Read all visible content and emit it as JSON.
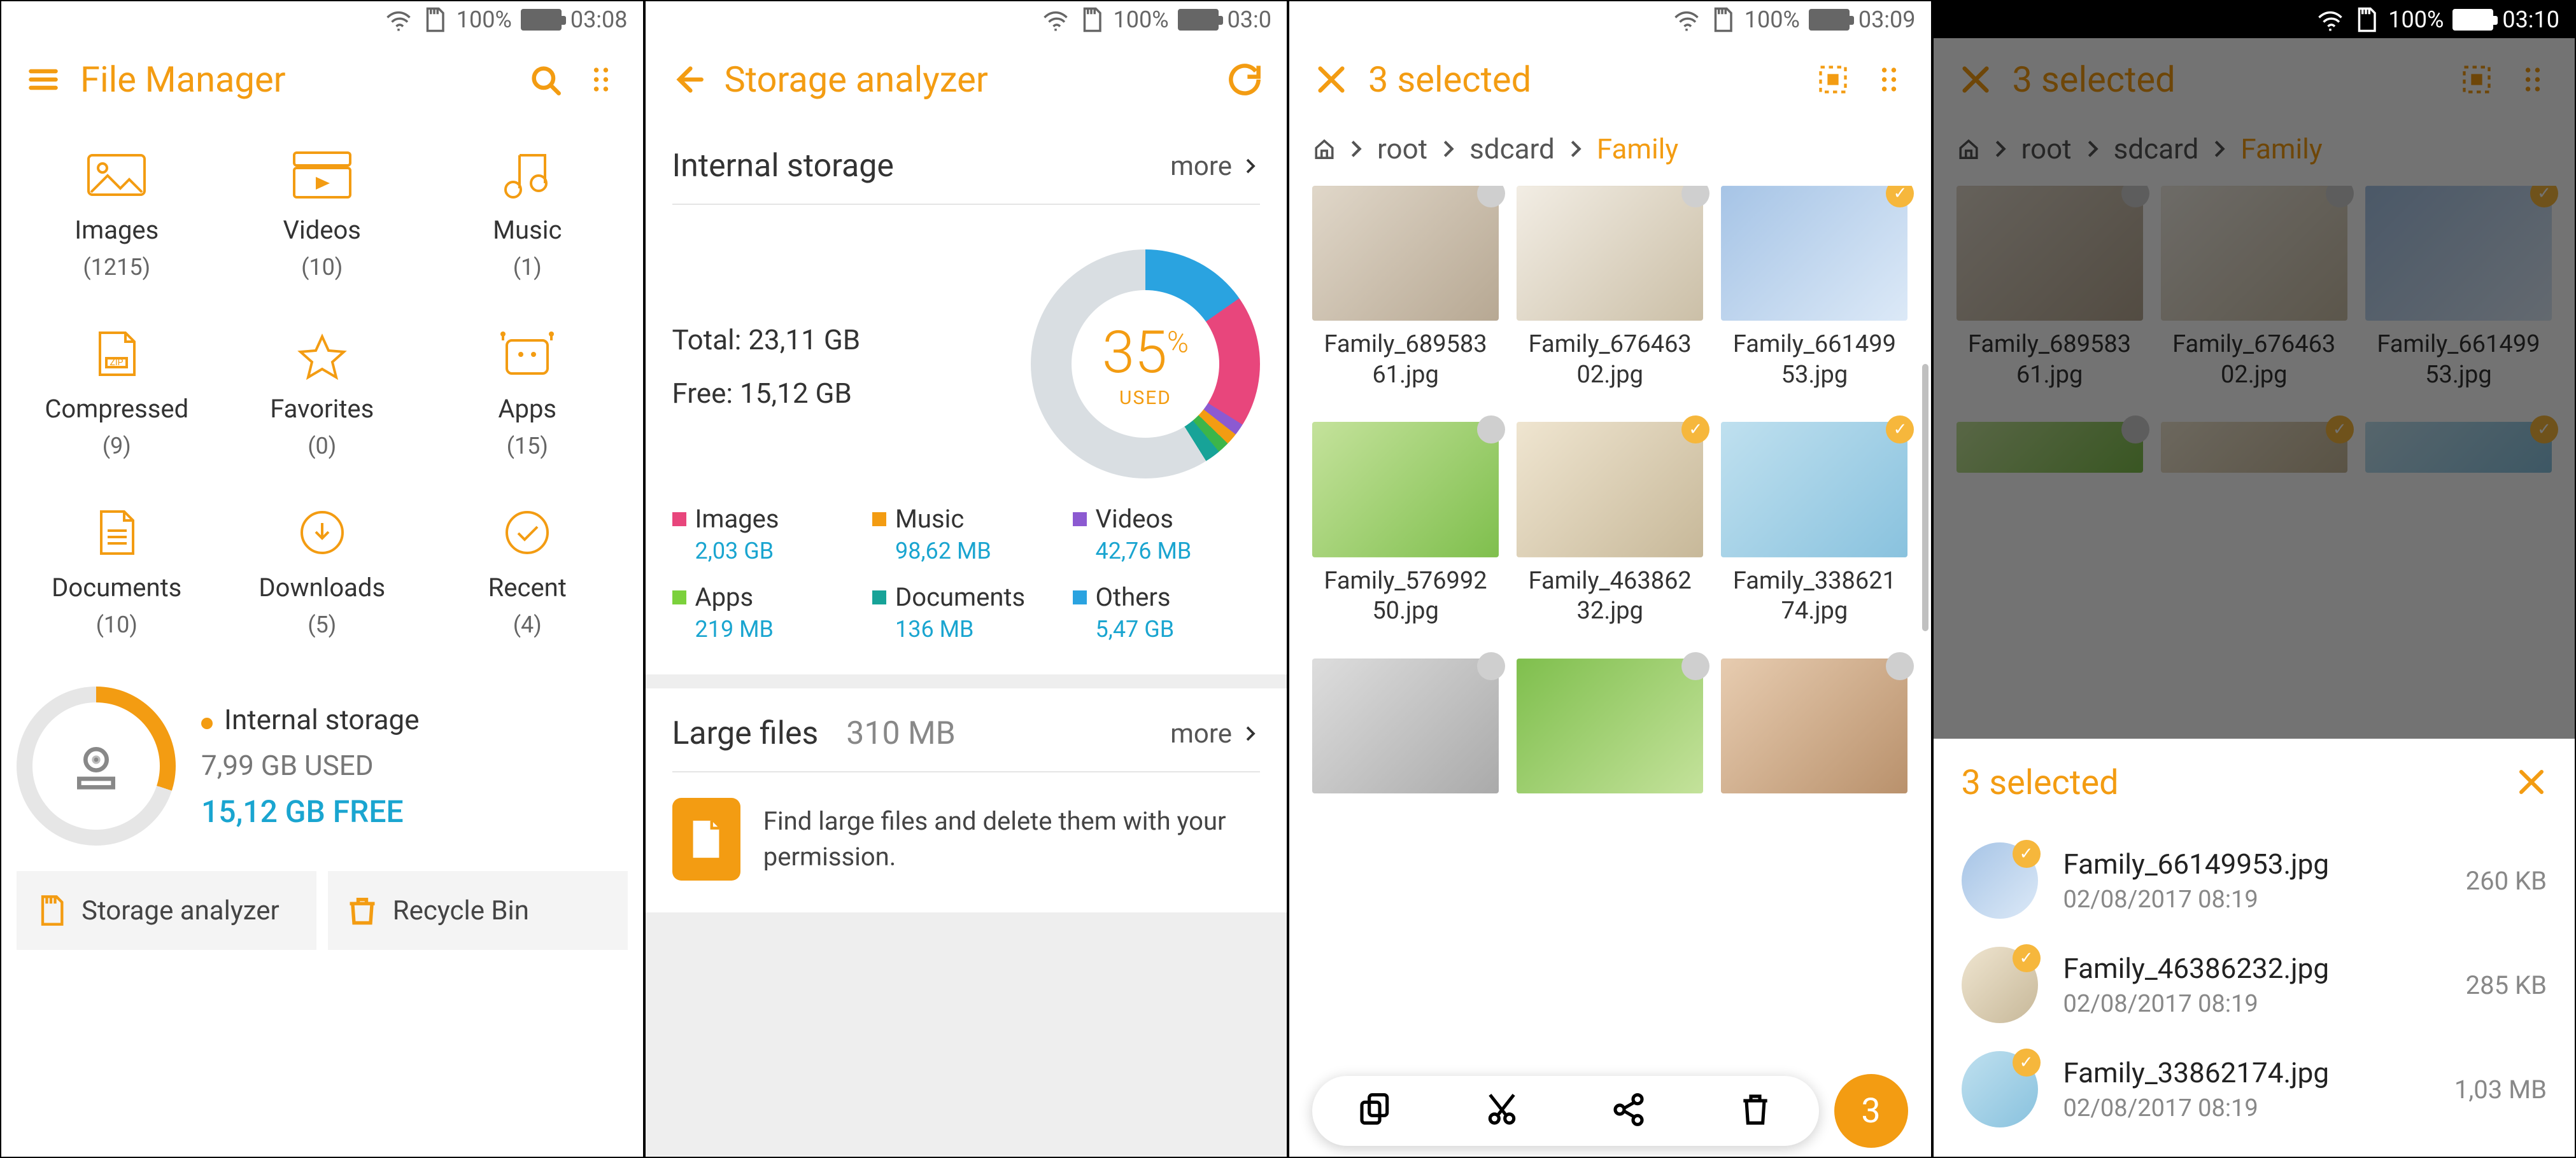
{
  "screen1": {
    "status": {
      "battery": "100%",
      "time": "03:08"
    },
    "title": "File Manager",
    "categories": [
      {
        "label": "Images",
        "count": "(1215)"
      },
      {
        "label": "Videos",
        "count": "(10)"
      },
      {
        "label": "Music",
        "count": "(1)"
      },
      {
        "label": "Compressed",
        "count": "(9)"
      },
      {
        "label": "Favorites",
        "count": "(0)"
      },
      {
        "label": "Apps",
        "count": "(15)"
      },
      {
        "label": "Documents",
        "count": "(10)"
      },
      {
        "label": "Downloads",
        "count": "(5)"
      },
      {
        "label": "Recent",
        "count": "(4)"
      }
    ],
    "storage": {
      "name": "Internal storage",
      "used": "7,99 GB USED",
      "free": "15,12 GB FREE"
    },
    "tiles": {
      "analyzer": "Storage analyzer",
      "recycle": "Recycle Bin"
    }
  },
  "screen2": {
    "status": {
      "battery": "100%",
      "time": "03:0"
    },
    "title": "Storage analyzer",
    "internal": {
      "heading": "Internal storage",
      "more": "more",
      "total_label": "Total:",
      "total_value": "23,11 GB",
      "free_label": "Free:",
      "free_value": "15,12 GB",
      "used_pct": "35",
      "used_unit": "%",
      "used_label": "USED",
      "legend": [
        {
          "name": "Images",
          "value": "2,03 GB",
          "cls": "c-img"
        },
        {
          "name": "Music",
          "value": "98,62 MB",
          "cls": "c-mus"
        },
        {
          "name": "Videos",
          "value": "42,76 MB",
          "cls": "c-vid"
        },
        {
          "name": "Apps",
          "value": "219 MB",
          "cls": "c-app"
        },
        {
          "name": "Documents",
          "value": "136 MB",
          "cls": "c-doc"
        },
        {
          "name": "Others",
          "value": "5,47 GB",
          "cls": "c-oth"
        }
      ]
    },
    "large": {
      "heading": "Large files",
      "size": "310 MB",
      "more": "more",
      "desc": "Find large files and delete them with your permission."
    }
  },
  "screen3": {
    "status": {
      "battery": "100%",
      "time": "03:09"
    },
    "title": "3 selected",
    "crumbs": {
      "root": "root",
      "sd": "sdcard",
      "cur": "Family"
    },
    "files": [
      {
        "name": "Family_68958361.jpg",
        "sel": false,
        "cls": "p1"
      },
      {
        "name": "Family_67646302.jpg",
        "sel": false,
        "cls": "p2"
      },
      {
        "name": "Family_66149953.jpg",
        "sel": true,
        "cls": "p3"
      },
      {
        "name": "Family_57699250.jpg",
        "sel": false,
        "cls": "p4"
      },
      {
        "name": "Family_46386232.jpg",
        "sel": true,
        "cls": "p5"
      },
      {
        "name": "Family_33862174.jpg",
        "sel": true,
        "cls": "p6"
      }
    ],
    "fab": "3"
  },
  "screen4": {
    "status": {
      "battery": "100%",
      "time": "03:10"
    },
    "title": "3 selected",
    "crumbs": {
      "root": "root",
      "sd": "sdcard",
      "cur": "Family"
    },
    "files": [
      {
        "name": "Family_68958361.jpg",
        "sel": false,
        "cls": "p1"
      },
      {
        "name": "Family_67646302.jpg",
        "sel": false,
        "cls": "p2"
      },
      {
        "name": "Family_66149953.jpg",
        "sel": true,
        "cls": "p3"
      }
    ],
    "sheet": {
      "title": "3 selected",
      "rows": [
        {
          "name": "Family_66149953.jpg",
          "date": "02/08/2017 08:19",
          "size": "260 KB",
          "cls": "ava3"
        },
        {
          "name": "Family_46386232.jpg",
          "date": "02/08/2017 08:19",
          "size": "285 KB",
          "cls": "ava5"
        },
        {
          "name": "Family_33862174.jpg",
          "date": "02/08/2017 08:19",
          "size": "1,03 MB",
          "cls": "ava6"
        }
      ]
    }
  }
}
